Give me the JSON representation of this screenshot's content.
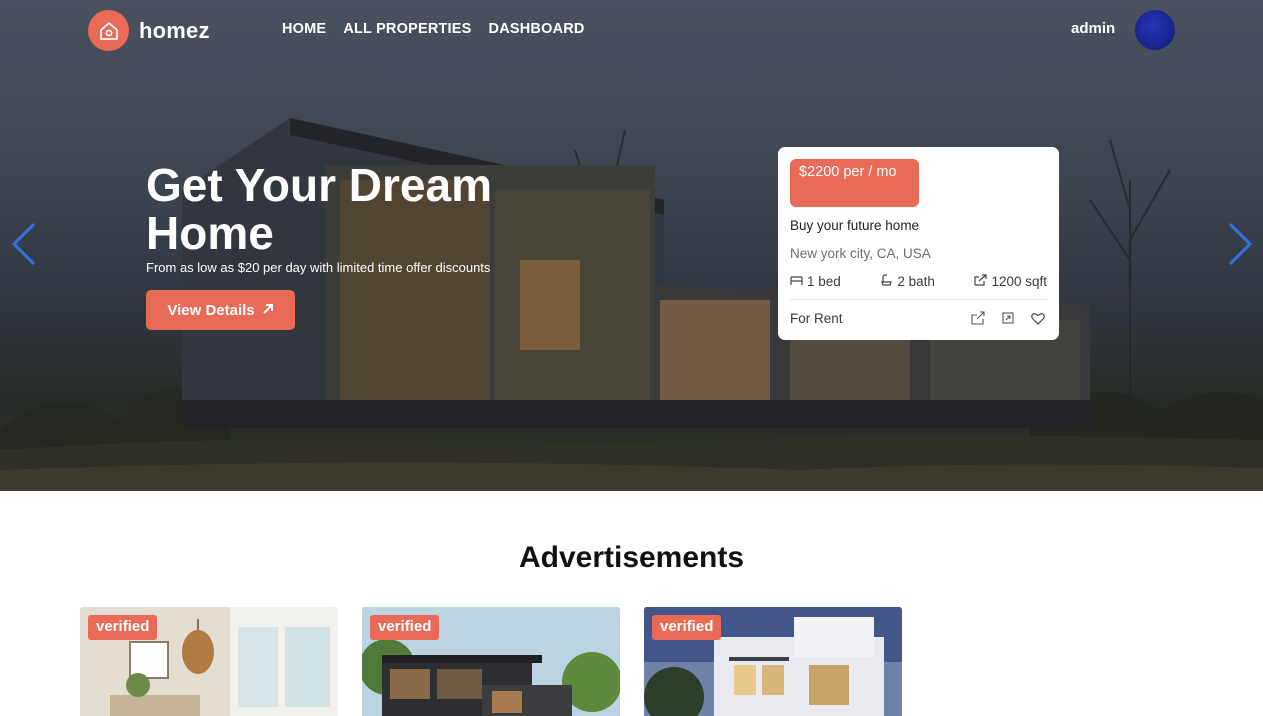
{
  "nav": {
    "brand": "homez",
    "menu": [
      "HOME",
      "ALL PROPERTIES",
      "DASHBOARD"
    ],
    "user_name": "admin"
  },
  "hero": {
    "title": "Get Your Dream Home",
    "subtitle": "From as low as $20 per day with limited time offer discounts",
    "cta_label": "View Details",
    "cta_icon": "arrow-up-right-icon"
  },
  "property_card": {
    "price": "$2200 per / mo",
    "title": "Buy your future home",
    "location": "New york city, CA, USA",
    "beds": "1 bed",
    "baths": "2 bath",
    "area": "1200 sqft",
    "status": "For Rent"
  },
  "advertisements": {
    "heading": "Advertisements",
    "cards": [
      {
        "badge": "verified"
      },
      {
        "badge": "verified"
      },
      {
        "badge": "verified"
      }
    ]
  },
  "colors": {
    "accent": "#e96a57",
    "arrow": "#2f6fe4",
    "avatar": "#1a2594"
  }
}
